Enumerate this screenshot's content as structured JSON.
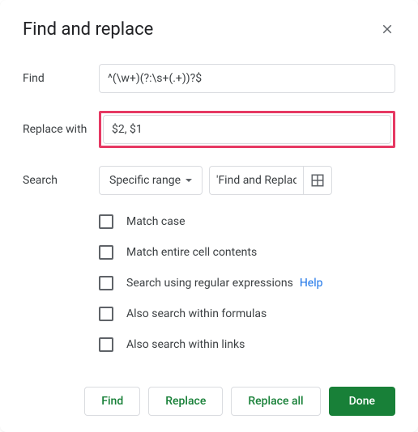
{
  "dialog": {
    "title": "Find and replace"
  },
  "fields": {
    "find_label": "Find",
    "find_value": "^(\\w+)(?:\\s+(.+))?$",
    "replace_label": "Replace with",
    "replace_value": "$2, $1",
    "search_label": "Search",
    "scope_selected": "Specific range",
    "range_value": "'Find and Replace"
  },
  "options": {
    "match_case": "Match case",
    "match_entire": "Match entire cell contents",
    "use_regex": "Search using regular expressions",
    "help": "Help",
    "within_formulas": "Also search within formulas",
    "within_links": "Also search within links"
  },
  "buttons": {
    "find": "Find",
    "replace": "Replace",
    "replace_all": "Replace all",
    "done": "Done"
  }
}
